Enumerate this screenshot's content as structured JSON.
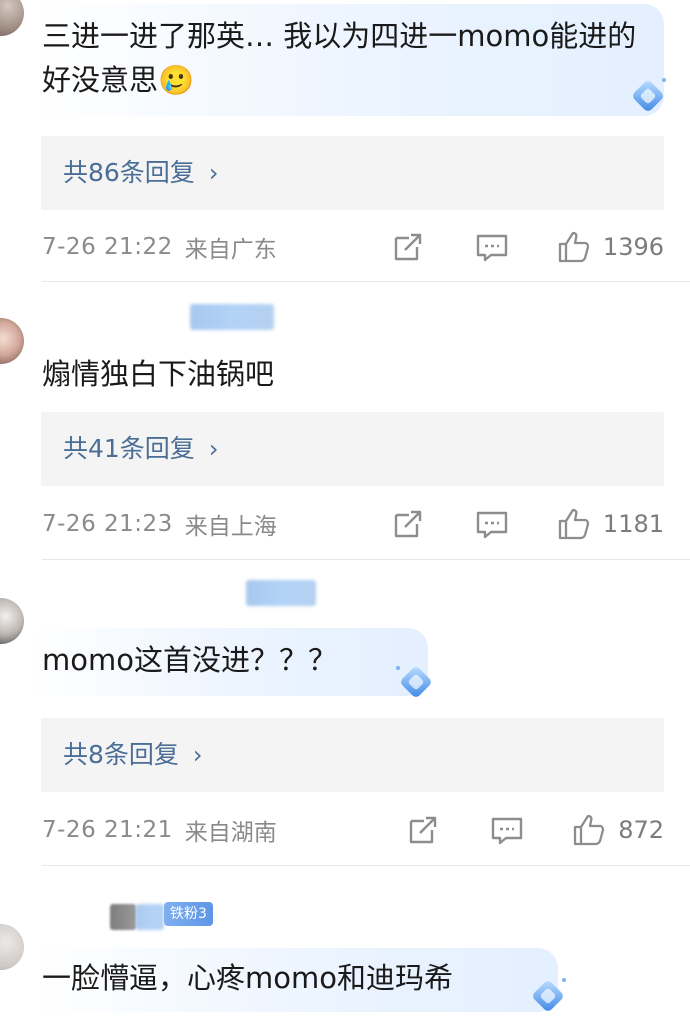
{
  "comments": [
    {
      "text": "三进一进了那英… 我以为四进一momo能进的 好没意思🥲",
      "replies_label": "共86条回复",
      "time": "7-26 21:22",
      "location": "来自广东",
      "likes": "1396"
    },
    {
      "text": "煽情独白下油锅吧",
      "replies_label": "共41条回复",
      "time": "7-26 21:23",
      "location": "来自上海",
      "likes": "1181"
    },
    {
      "text": "momo这首没进？？？",
      "replies_label": "共8条回复",
      "time": "7-26 21:21",
      "location": "来自湖南",
      "likes": "872"
    },
    {
      "text": "一脸懵逼，心疼momo和迪玛希",
      "fan_badge": "铁粉3"
    }
  ],
  "icons": {
    "reply_chevron": "chevron-right-icon",
    "share": "share-icon",
    "comment": "comment-icon",
    "like": "thumbs-up-icon",
    "decoration": "diamond-decoration-icon"
  },
  "colors": {
    "reply_link": "#4a6e95",
    "meta_text": "#8a8a8a",
    "reply_bg": "#f4f4f4",
    "bubble": "#e1eeff"
  }
}
